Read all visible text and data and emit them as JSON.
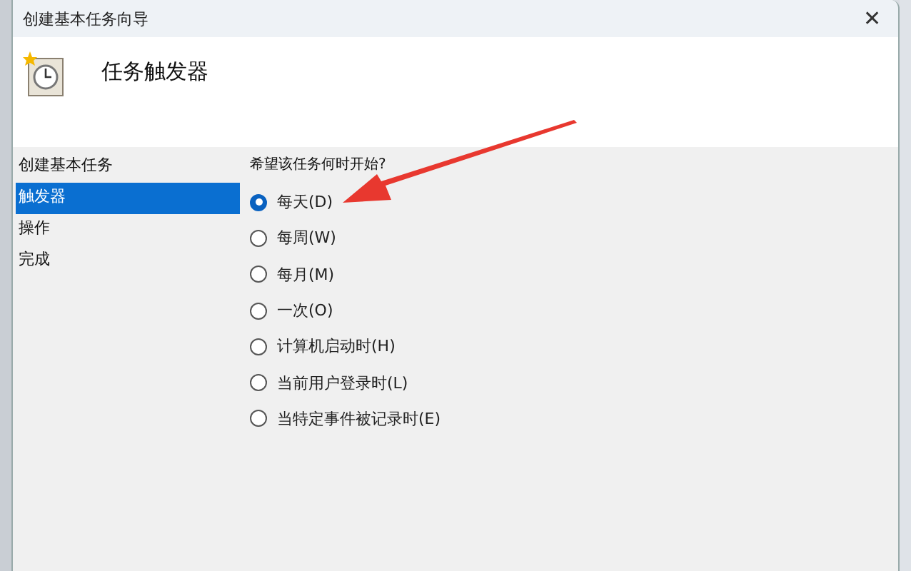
{
  "window": {
    "title": "创建基本任务向导",
    "close": "✕"
  },
  "header": {
    "title": "任务触发器"
  },
  "sidebar": {
    "items": [
      {
        "label": "创建基本任务",
        "selected": false
      },
      {
        "label": "触发器",
        "selected": true
      },
      {
        "label": "操作",
        "selected": false
      },
      {
        "label": "完成",
        "selected": false
      }
    ]
  },
  "question": "希望该任务何时开始?",
  "options": [
    {
      "label": "每天(D)",
      "selected": true
    },
    {
      "label": "每周(W)",
      "selected": false
    },
    {
      "label": "每月(M)",
      "selected": false
    },
    {
      "label": "一次(O)",
      "selected": false
    },
    {
      "label": "计算机启动时(H)",
      "selected": false
    },
    {
      "label": "当前用户登录时(L)",
      "selected": false
    },
    {
      "label": "当特定事件被记录时(E)",
      "selected": false
    }
  ]
}
